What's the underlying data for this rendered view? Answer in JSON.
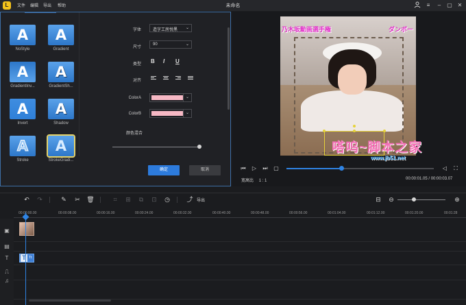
{
  "titlebar": {
    "logo": "L",
    "menu": [
      "文件",
      "编辑",
      "导出",
      "帮助"
    ],
    "title": "未命名",
    "controls": [
      "user-icon",
      "menu-icon",
      "minimize-icon",
      "maximize-icon",
      "close-icon"
    ]
  },
  "styles": [
    {
      "name": "NoStyle"
    },
    {
      "name": "Gradient"
    },
    {
      "name": "GradientInv..."
    },
    {
      "name": "GradientSh..."
    },
    {
      "name": "Invert"
    },
    {
      "name": "Shadow"
    },
    {
      "name": "Stroke"
    },
    {
      "name": "StrokeGradi..."
    }
  ],
  "style_glyph": "A",
  "props": {
    "font_label": "字体",
    "font_value": "造字工房悦黑",
    "size_label": "尺寸",
    "size_value": "90",
    "type_label": "类型",
    "type_bold": "B",
    "type_italic": "I",
    "type_underline": "U",
    "align_label": "对齐",
    "colorA_label": "ColorA",
    "colorA_value": "#f6b8c4",
    "colorB_label": "ColorB",
    "colorB_value": "#f6b8c4",
    "blend_label": "颜色混合",
    "blend_level": 0.98
  },
  "buttons": {
    "ok": "确定",
    "cancel": "取消"
  },
  "preview": {
    "overlay_left": "乃木坂動画選手権",
    "overlay_right": "ダンボー",
    "watermark": "嗒呜~脚本之家",
    "watermark_url": "www.jb51.net",
    "aspect_label": "宽高比",
    "aspect_value": "1 : 1",
    "timecode": "00:00:01.05 / 00:00:03.07",
    "progress": 0.37
  },
  "toolbar": {
    "export_label": "导出"
  },
  "timeline": {
    "ticks": [
      "00:00:00.00",
      "00:00:08.00",
      "00:00:16.00",
      "00:00:24.00",
      "00:00:32.00",
      "00:00:40.00",
      "00:00:48.00",
      "00:00:56.00",
      "00:01:04.00",
      "00:01:12.00",
      "00:01:20.00",
      "00:01:28"
    ],
    "text_clip_glyph": "T",
    "text_clip_label": "Tt"
  }
}
